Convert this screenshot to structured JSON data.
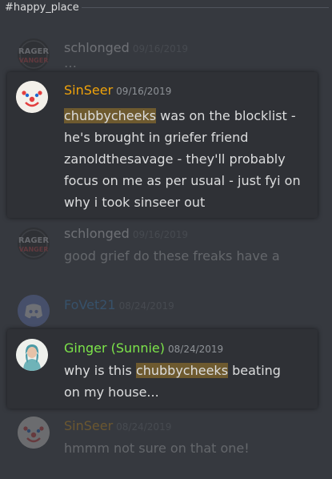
{
  "channel": {
    "name": "#happy_place"
  },
  "colors": {
    "background": "#36393f",
    "card": "#2f3136",
    "sinseer": "#f0a30a",
    "ginger": "#7de54a",
    "fovet": "#3a8fd8",
    "schlonged": "#ffffff",
    "mention_bg": "#6e5a2f"
  },
  "messages": [
    {
      "author": "schlonged",
      "timestamp": "09/16/2019",
      "avatar_icon": "rager-logo-icon",
      "avatar_text": [
        "RAGER",
        "VANGER"
      ],
      "text_partial": "… "
    },
    {
      "author": "SinSeer",
      "timestamp": "09/16/2019",
      "avatar_icon": "clown-icon",
      "mention": "chubbycheeks",
      "lines": [
        " was on the blocklist -",
        "he's brought in griefer friend",
        "zanoldthesavage - they'll probably",
        "focus on me as per usual - just fyi on",
        "why i took sinseer out"
      ]
    },
    {
      "author": "schlonged",
      "timestamp": "09/16/2019",
      "avatar_icon": "rager-logo-icon",
      "avatar_text": [
        "RAGER",
        "VANGER"
      ],
      "text": "good grief do these freaks have a"
    },
    {
      "author": "FoVet21",
      "timestamp": "08/24/2019",
      "avatar_icon": "discord-logo-icon"
    },
    {
      "author": "Ginger (Sunnie)",
      "timestamp": "08/24/2019",
      "avatar_icon": "user-photo-icon",
      "prefix": "why is this ",
      "mention": "chubbycheeks",
      "suffix": "  beating",
      "line2": "on my house..."
    },
    {
      "author": "SinSeer",
      "timestamp": "08/24/2019",
      "avatar_icon": "clown-icon",
      "text": "hmmm not sure on that one!"
    }
  ]
}
